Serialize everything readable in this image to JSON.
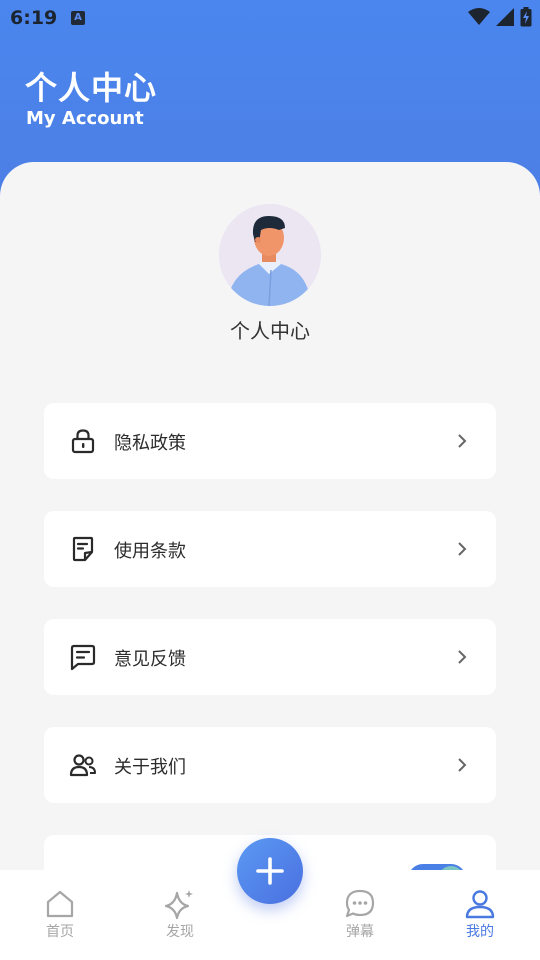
{
  "status_bar": {
    "time": "6:19",
    "indicator_letter": "A"
  },
  "header": {
    "title": "个人中心",
    "subtitle": "My Account"
  },
  "profile": {
    "name": "个人中心"
  },
  "menu": [
    {
      "label": "隐私政策",
      "icon": "lock-icon"
    },
    {
      "label": "使用条款",
      "icon": "document-icon"
    },
    {
      "label": "意见反馈",
      "icon": "feedback-icon"
    },
    {
      "label": "关于我们",
      "icon": "users-icon"
    }
  ],
  "tabbar": {
    "tabs": [
      {
        "label": "首页",
        "icon": "home-icon",
        "active": false
      },
      {
        "label": "发现",
        "icon": "sparkle-icon",
        "active": false
      },
      {
        "label": "弹幕",
        "icon": "chat-icon",
        "active": false
      },
      {
        "label": "我的",
        "icon": "user-icon",
        "active": true
      }
    ],
    "fab_icon": "plus-icon"
  },
  "colors": {
    "header_top": "#4a86ee",
    "accent": "#4a79e0",
    "inactive": "#a6a6a6",
    "sheet": "#f5f5f6"
  }
}
